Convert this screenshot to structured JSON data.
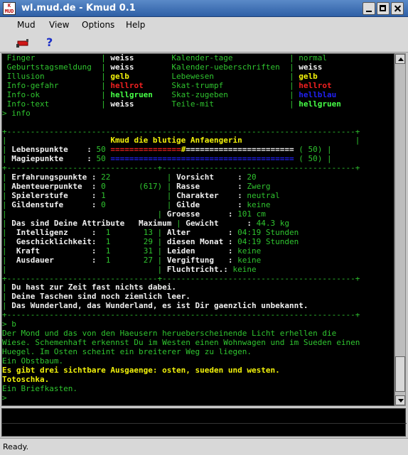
{
  "window": {
    "title": "wl.mud.de - Kmud 0.1",
    "icon_label": "K\nMUD",
    "controls": [
      "minimize",
      "maximize",
      "close"
    ]
  },
  "menu": {
    "items": [
      "Mud",
      "View",
      "Options",
      "Help"
    ]
  },
  "toolbar": {
    "buttons": [
      {
        "name": "connect-icon",
        "label": ""
      },
      {
        "name": "help-icon",
        "label": "?"
      }
    ]
  },
  "colors": {
    "green": "#2fc42f",
    "white": "#f0f0f0",
    "yellow": "#f2f20a",
    "red": "#f02020",
    "blue": "#2020f0",
    "bgreen": "#46ff46"
  },
  "terminal": {
    "lines": [
      [
        [
          "g",
          " Finger              | "
        ],
        [
          "w",
          "weiss"
        ],
        [
          "g",
          "        Kalender-tage            | "
        ],
        [
          "g",
          "normal"
        ]
      ],
      [
        [
          "g",
          " Geburtstagsmeldung  | "
        ],
        [
          "w",
          "weiss"
        ],
        [
          "g",
          "        Kalender-ueberschriften  | "
        ],
        [
          "w",
          "weiss"
        ]
      ],
      [
        [
          "g",
          " Illusion            | "
        ],
        [
          "y",
          "gelb"
        ],
        [
          "g",
          "         Lebewesen                | "
        ],
        [
          "y",
          "gelb"
        ]
      ],
      [
        [
          "g",
          " Info-gefahr         | "
        ],
        [
          "r",
          "hellrot"
        ],
        [
          "g",
          "      Skat-trumpf              | "
        ],
        [
          "r",
          "hellrot"
        ]
      ],
      [
        [
          "g",
          " Info-ok             | "
        ],
        [
          "G",
          "hellgruen"
        ],
        [
          "g",
          "    Skat-zugeben             | "
        ],
        [
          "b",
          "hellblau"
        ]
      ],
      [
        [
          "g",
          " Info-text           | "
        ],
        [
          "w",
          "weiss"
        ],
        [
          "g",
          "        Teile-mit                | "
        ],
        [
          "G",
          "hellgruen"
        ]
      ],
      [
        [
          "g",
          "> info"
        ]
      ],
      [
        [
          "g",
          ""
        ]
      ],
      [
        [
          "g",
          "+--------------------------------------------------------------------------+"
        ]
      ],
      [
        [
          "g",
          "|                      "
        ],
        [
          "y",
          "Kmud die blutige Anfaengerin"
        ],
        [
          "g",
          "                        |"
        ]
      ],
      [
        [
          "g",
          "| "
        ],
        [
          "w",
          "Lebenspunkte    :"
        ],
        [
          "g",
          " 50 "
        ],
        [
          "r",
          "==============="
        ],
        [
          "y",
          "#"
        ],
        [
          "w",
          "======================="
        ],
        [
          "g",
          " ( 50) |"
        ]
      ],
      [
        [
          "g",
          "| "
        ],
        [
          "w",
          "Magiepunkte     :"
        ],
        [
          "g",
          " 50 "
        ],
        [
          "b",
          "======================================="
        ],
        [
          "g",
          " ( 50) |"
        ]
      ],
      [
        [
          "g",
          "+--------------------------------+-----------------------------------------+"
        ]
      ],
      [
        [
          "g",
          "| "
        ],
        [
          "w",
          "Erfahrungspunkte :"
        ],
        [
          "g",
          " 22            | "
        ],
        [
          "w",
          "Vorsicht     :"
        ],
        [
          "g",
          " 20"
        ]
      ],
      [
        [
          "g",
          "| "
        ],
        [
          "w",
          "Abenteuerpunkte  :"
        ],
        [
          "g",
          " 0       (617) | "
        ],
        [
          "w",
          "Rasse        :"
        ],
        [
          "g",
          " Zwerg"
        ]
      ],
      [
        [
          "g",
          "| "
        ],
        [
          "w",
          "Spielerstufe     :"
        ],
        [
          "g",
          " 1             | "
        ],
        [
          "w",
          "Charakter    :"
        ],
        [
          "g",
          " neutral"
        ]
      ],
      [
        [
          "g",
          "| "
        ],
        [
          "w",
          "Gildenstufe      :"
        ],
        [
          "g",
          " 0             | "
        ],
        [
          "w",
          "Gilde        :"
        ],
        [
          "g",
          " keine"
        ]
      ],
      [
        [
          "g",
          "|                                | "
        ],
        [
          "w",
          "Groesse      :"
        ],
        [
          "g",
          " 101 cm"
        ]
      ],
      [
        [
          "g",
          "| "
        ],
        [
          "w",
          "Das sind Deine Attribute   Maximum"
        ],
        [
          "g",
          " | "
        ],
        [
          "w",
          "Gewicht      :"
        ],
        [
          "g",
          " 44.3 kg"
        ]
      ],
      [
        [
          "g",
          "|  "
        ],
        [
          "w",
          "Intelligenz     :"
        ],
        [
          "g",
          "  1       13 | "
        ],
        [
          "w",
          "Alter        :"
        ],
        [
          "g",
          " 04:19 Stunden"
        ]
      ],
      [
        [
          "g",
          "|  "
        ],
        [
          "w",
          "Geschicklichkeit:"
        ],
        [
          "g",
          "  1       29 | "
        ],
        [
          "w",
          "diesen Monat :"
        ],
        [
          "g",
          " 04:19 Stunden"
        ]
      ],
      [
        [
          "g",
          "|  "
        ],
        [
          "w",
          "Kraft           :"
        ],
        [
          "g",
          "  1       31 | "
        ],
        [
          "w",
          "Leiden       :"
        ],
        [
          "g",
          " keine"
        ]
      ],
      [
        [
          "g",
          "|  "
        ],
        [
          "w",
          "Ausdauer        :"
        ],
        [
          "g",
          "  1       27 | "
        ],
        [
          "w",
          "Vergiftung   :"
        ],
        [
          "g",
          " keine"
        ]
      ],
      [
        [
          "g",
          "|                                | "
        ],
        [
          "w",
          "Fluchtricht.:"
        ],
        [
          "g",
          " keine"
        ]
      ],
      [
        [
          "g",
          "+--------------------------------+-----------------------------------------+"
        ]
      ],
      [
        [
          "g",
          "| "
        ],
        [
          "w",
          "Du hast zur Zeit fast nichts dabei."
        ]
      ],
      [
        [
          "g",
          "| "
        ],
        [
          "w",
          "Deine Taschen sind noch ziemlich leer."
        ]
      ],
      [
        [
          "g",
          "| "
        ],
        [
          "w",
          "Das Wunderland, das Wunderland, es ist Dir gaenzlich unbekannt."
        ]
      ],
      [
        [
          "g",
          "+--------------------------------------------------------------------------+"
        ]
      ],
      [
        [
          "g",
          "> b"
        ]
      ],
      [
        [
          "g",
          "Der Mond und das von den Haeusern herueberscheinende Licht erhellen die"
        ]
      ],
      [
        [
          "g",
          "Wiese. Schemenhaft erkennst Du im Westen einen Wohnwagen und im Sueden einen"
        ]
      ],
      [
        [
          "g",
          "Huegel. Im Osten scheint ein breiterer Weg zu liegen."
        ]
      ],
      [
        [
          "g",
          "Ein Obstbaum."
        ]
      ],
      [
        [
          "y",
          "Es gibt drei sichtbare Ausgaenge: osten, sueden und westen."
        ]
      ],
      [
        [
          "y",
          "Totoschka."
        ]
      ],
      [
        [
          "g",
          "Ein Briefkasten."
        ]
      ],
      [
        [
          "g",
          ">"
        ]
      ]
    ]
  },
  "scrollbar": {
    "position": 0.86
  },
  "input": {
    "value": ""
  },
  "status": {
    "text": "Ready."
  }
}
